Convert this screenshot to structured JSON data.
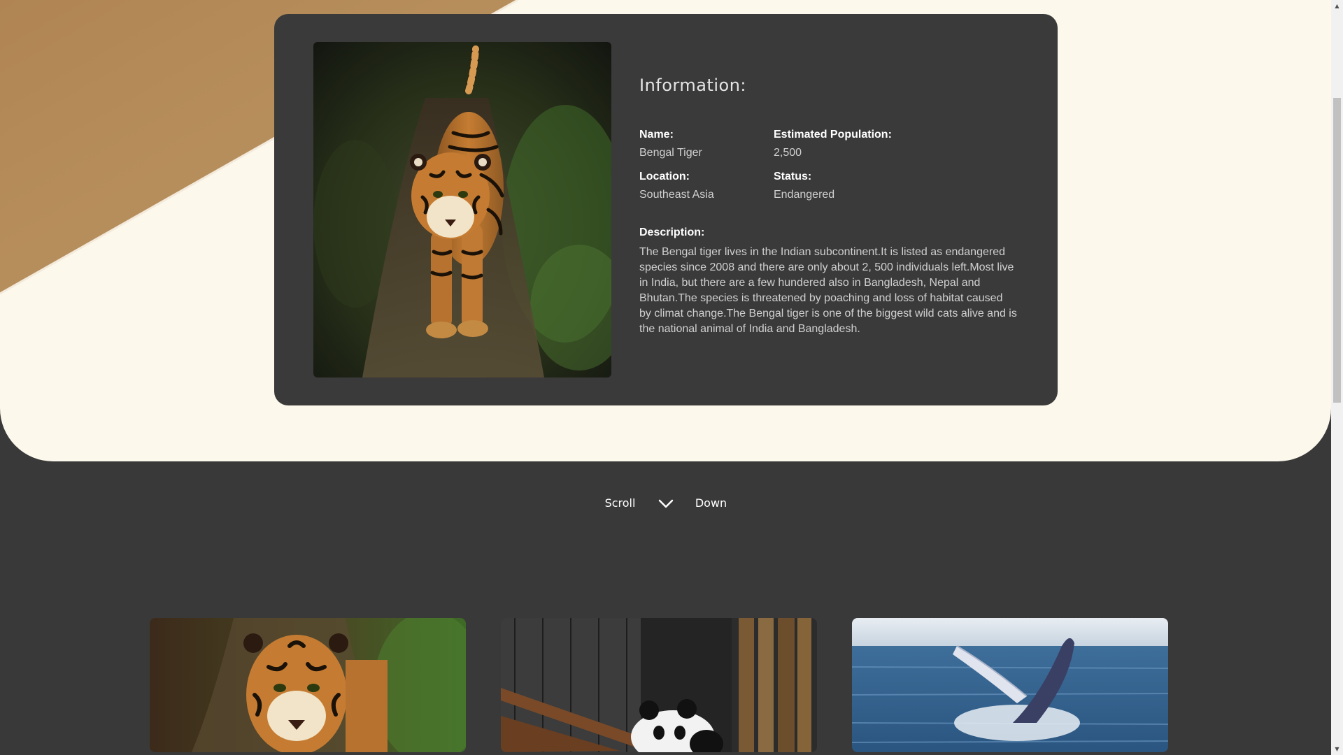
{
  "info": {
    "heading": "Information:",
    "fields": [
      {
        "label": "Name:",
        "value": "Bengal Tiger"
      },
      {
        "label": "Estimated Population:",
        "value": "2,500"
      },
      {
        "label": "Location:",
        "value": "Southeast Asia"
      },
      {
        "label": "Status:",
        "value": "Endangered"
      }
    ],
    "description_label": "Description:",
    "description": "The Bengal tiger lives in the Indian subcontinent.It is listed as endangered species since 2008 and there are only about 2, 500 individuals left.Most live in India, but there are a few hundered also in Bangladesh, Nepal and Bhutan.The species is threatened by poaching and loss of habitat caused by climat change.The Bengal tiger is one of the biggest wild cats alive and is the national animal of India and Bangladesh."
  },
  "scroll_hint": {
    "left_word": "Scroll",
    "right_word": "Down",
    "icon": "chevron-down-icon"
  },
  "gallery": [
    {
      "subject": "tiger-photo"
    },
    {
      "subject": "panda-photo"
    },
    {
      "subject": "whale-photo"
    }
  ],
  "colors": {
    "page_dark": "#393939",
    "card_dark": "#3a3a3a",
    "cream": "#fdf8ec",
    "tan_band": "#b48a5a"
  }
}
